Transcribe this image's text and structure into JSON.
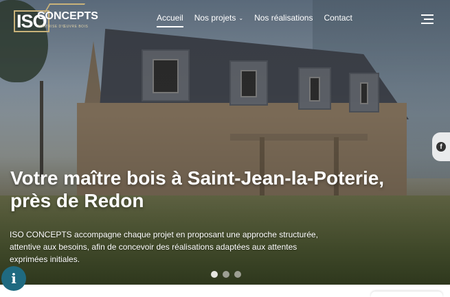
{
  "logo": {
    "iso": "ISO",
    "concepts": "CONCEPTS",
    "tagline": "MAÎTRISE D'ŒUVRE BOIS"
  },
  "nav": {
    "items": [
      {
        "label": "Accueil"
      },
      {
        "label": "Nos projets"
      },
      {
        "label": "Nos réalisations"
      },
      {
        "label": "Contact"
      }
    ],
    "active": "Accueil"
  },
  "hero": {
    "title": "Votre maître bois à Saint-Jean-la-Poterie, près de Redon",
    "description": "ISO CONCEPTS accompagne chaque projet en proposant une approche structurée, attentive aux besoins, afin de concevoir des réalisations adaptées aux attentes exprimées initiales.",
    "slides_total": 3,
    "slide_active": 1
  },
  "social": {
    "facebook_glyph": "f"
  },
  "info_badge": {
    "glyph": "i"
  },
  "colors": {
    "accent": "#1f6a80",
    "gold": "#c9b27a"
  }
}
